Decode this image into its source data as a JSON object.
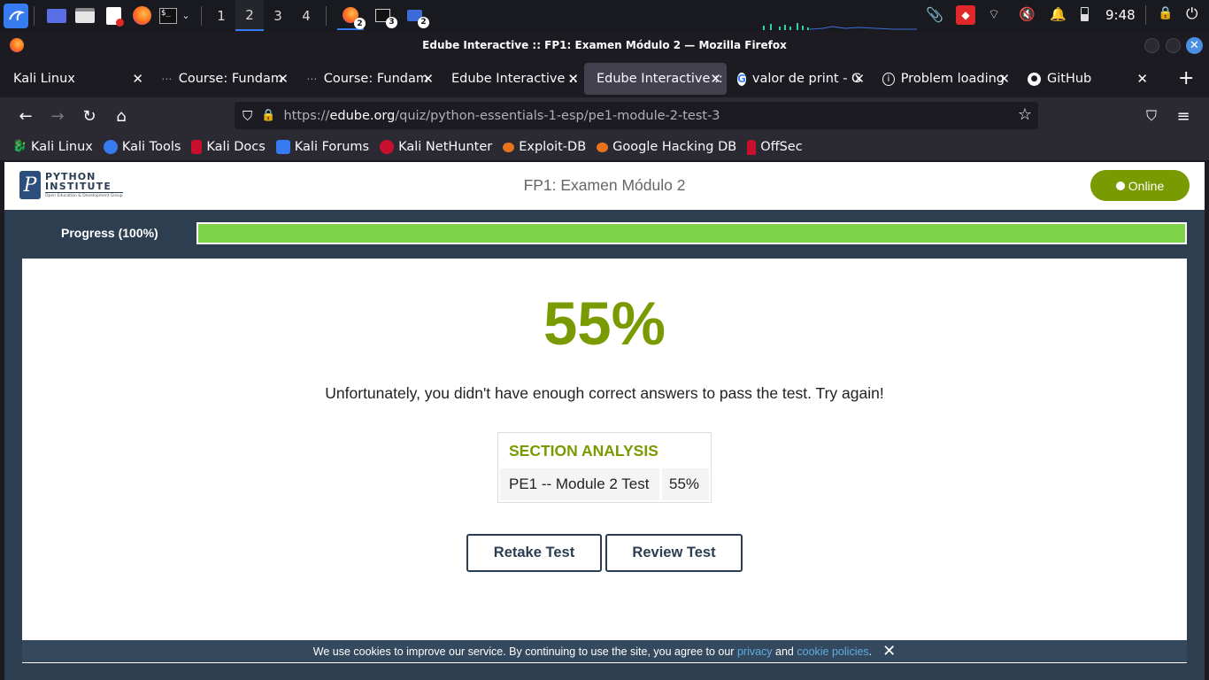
{
  "taskbar": {
    "workspaces": [
      "1",
      "2",
      "3",
      "4"
    ],
    "active_workspace": "2",
    "app_badges": [
      "2",
      "3",
      "2"
    ],
    "time": "9:48"
  },
  "window": {
    "title": "Edube Interactive :: FP1: Examen Módulo 2 — Mozilla Firefox"
  },
  "tabs": [
    {
      "label": "Kali Linux"
    },
    {
      "label": "Course: Fundam"
    },
    {
      "label": "Course: Fundam"
    },
    {
      "label": "Edube Interactive ::"
    },
    {
      "label": "Edube Interactive ::"
    },
    {
      "label": "valor de print - G"
    },
    {
      "label": "Problem loading"
    },
    {
      "label": "GitHub"
    }
  ],
  "url": {
    "prefix": "https://",
    "host": "edube.org",
    "path": "/quiz/python-essentials-1-esp/pe1-module-2-test-3"
  },
  "bookmarks": [
    "Kali Linux",
    "Kali Tools",
    "Kali Docs",
    "Kali Forums",
    "Kali NetHunter",
    "Exploit-DB",
    "Google Hacking DB",
    "OffSec"
  ],
  "site": {
    "logo_line1": "PYTHON",
    "logo_line2": "INSTITUTE",
    "logo_line3": "Open Education & Development Group",
    "quiz_title": "FP1: Examen Módulo 2",
    "status": "Online",
    "progress_label": "Progress (100%)",
    "progress_value": 100,
    "score": "55%",
    "message": "Unfortunately, you didn't have enough correct answers to pass the test. Try again!",
    "analysis_title": "SECTION ANALYSIS",
    "analysis_rows": [
      {
        "section": "PE1 -- Module 2 Test",
        "score": "55%"
      }
    ],
    "retake_label": "Retake Test",
    "review_label": "Review Test"
  },
  "cookie": {
    "text": "We use cookies to improve our service. By continuing to use the site, you agree to our",
    "privacy": "privacy",
    "and": "and",
    "policies": "cookie policies",
    "end": "."
  },
  "colors": {
    "accent": "#7a9a01",
    "progress": "#7ed348",
    "navy": "#2c3e50"
  }
}
